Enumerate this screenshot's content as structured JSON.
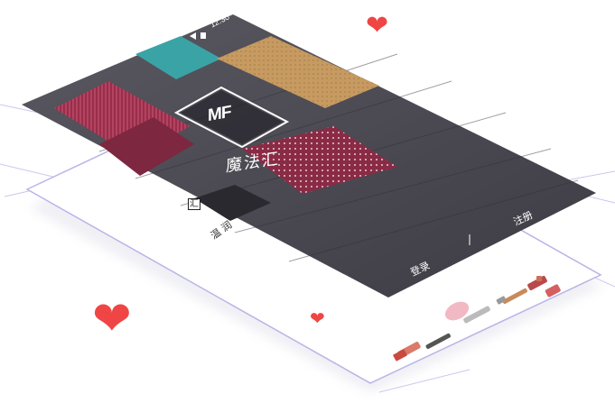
{
  "status_bar": {
    "time": "12:30",
    "icons": [
      "signal-icon",
      "battery-icon"
    ]
  },
  "splash": {
    "logo_text": "MF",
    "app_name": "魔法汇",
    "register_label": "注册",
    "login_label": "登录"
  },
  "back_screen": {
    "badge_text": "汇",
    "label_text": "温 润",
    "products": [
      "lipstick",
      "brush",
      "mascara",
      "brush",
      "lipstick",
      "lipstick"
    ]
  },
  "colors": {
    "accent_heart": "#f04545",
    "overlay": "#4a4a5c",
    "gift_red": "#8a2b45",
    "guide_line": "#c9c7ef"
  }
}
